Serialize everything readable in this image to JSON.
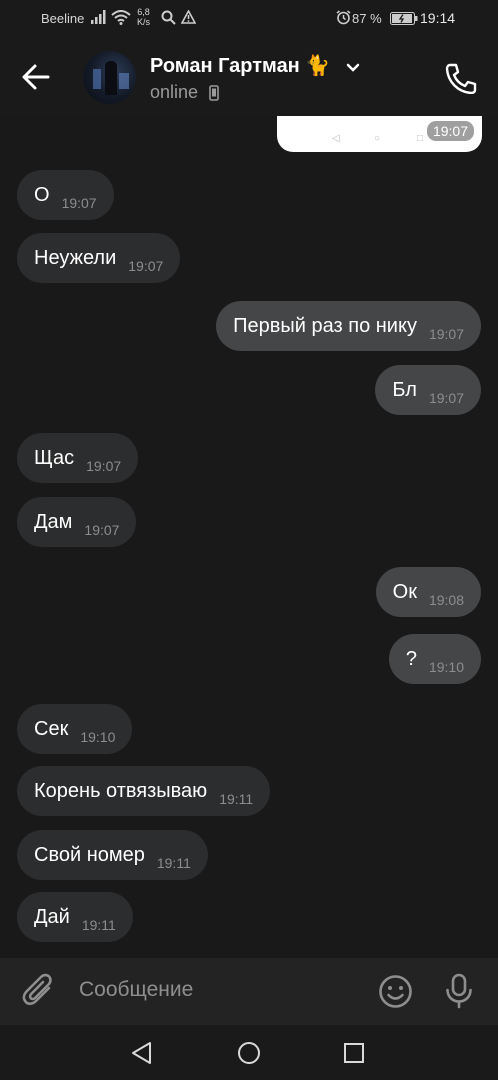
{
  "status_bar": {
    "carrier": "Beeline",
    "speed_value": "6,8",
    "speed_unit": "K/s",
    "battery_percent": "87 %",
    "time": "19:14"
  },
  "header": {
    "contact_name": "Роман Гартман 🐈",
    "status": "online"
  },
  "image_message": {
    "time": "19:07"
  },
  "messages": [
    {
      "direction": "in",
      "text": "О",
      "time": "19:07"
    },
    {
      "direction": "in",
      "text": "Неужели",
      "time": "19:07"
    },
    {
      "direction": "out",
      "text": "Первый раз по нику",
      "time": "19:07"
    },
    {
      "direction": "out",
      "text": "Бл",
      "time": "19:07"
    },
    {
      "direction": "in",
      "text": "Щас",
      "time": "19:07"
    },
    {
      "direction": "in",
      "text": "Дам",
      "time": "19:07"
    },
    {
      "direction": "out",
      "text": "Ок",
      "time": "19:08"
    },
    {
      "direction": "out",
      "text": "?",
      "time": "19:10"
    },
    {
      "direction": "in",
      "text": "Сек",
      "time": "19:10"
    },
    {
      "direction": "in",
      "text": "Корень отвязываю",
      "time": "19:11"
    },
    {
      "direction": "in",
      "text": "Свой номер",
      "time": "19:11"
    },
    {
      "direction": "in",
      "text": "Дай",
      "time": "19:11"
    }
  ],
  "composer": {
    "placeholder": "Сообщение"
  },
  "icons": {
    "back": "arrow-left-icon",
    "call": "phone-icon",
    "attach": "paperclip-icon",
    "emoji": "smile-icon",
    "voice": "microphone-icon"
  },
  "colors": {
    "background": "#19191a",
    "incoming_bubble": "#2c2d2e",
    "outgoing_bubble": "#454647",
    "timestamp": "#8d8d8d"
  }
}
